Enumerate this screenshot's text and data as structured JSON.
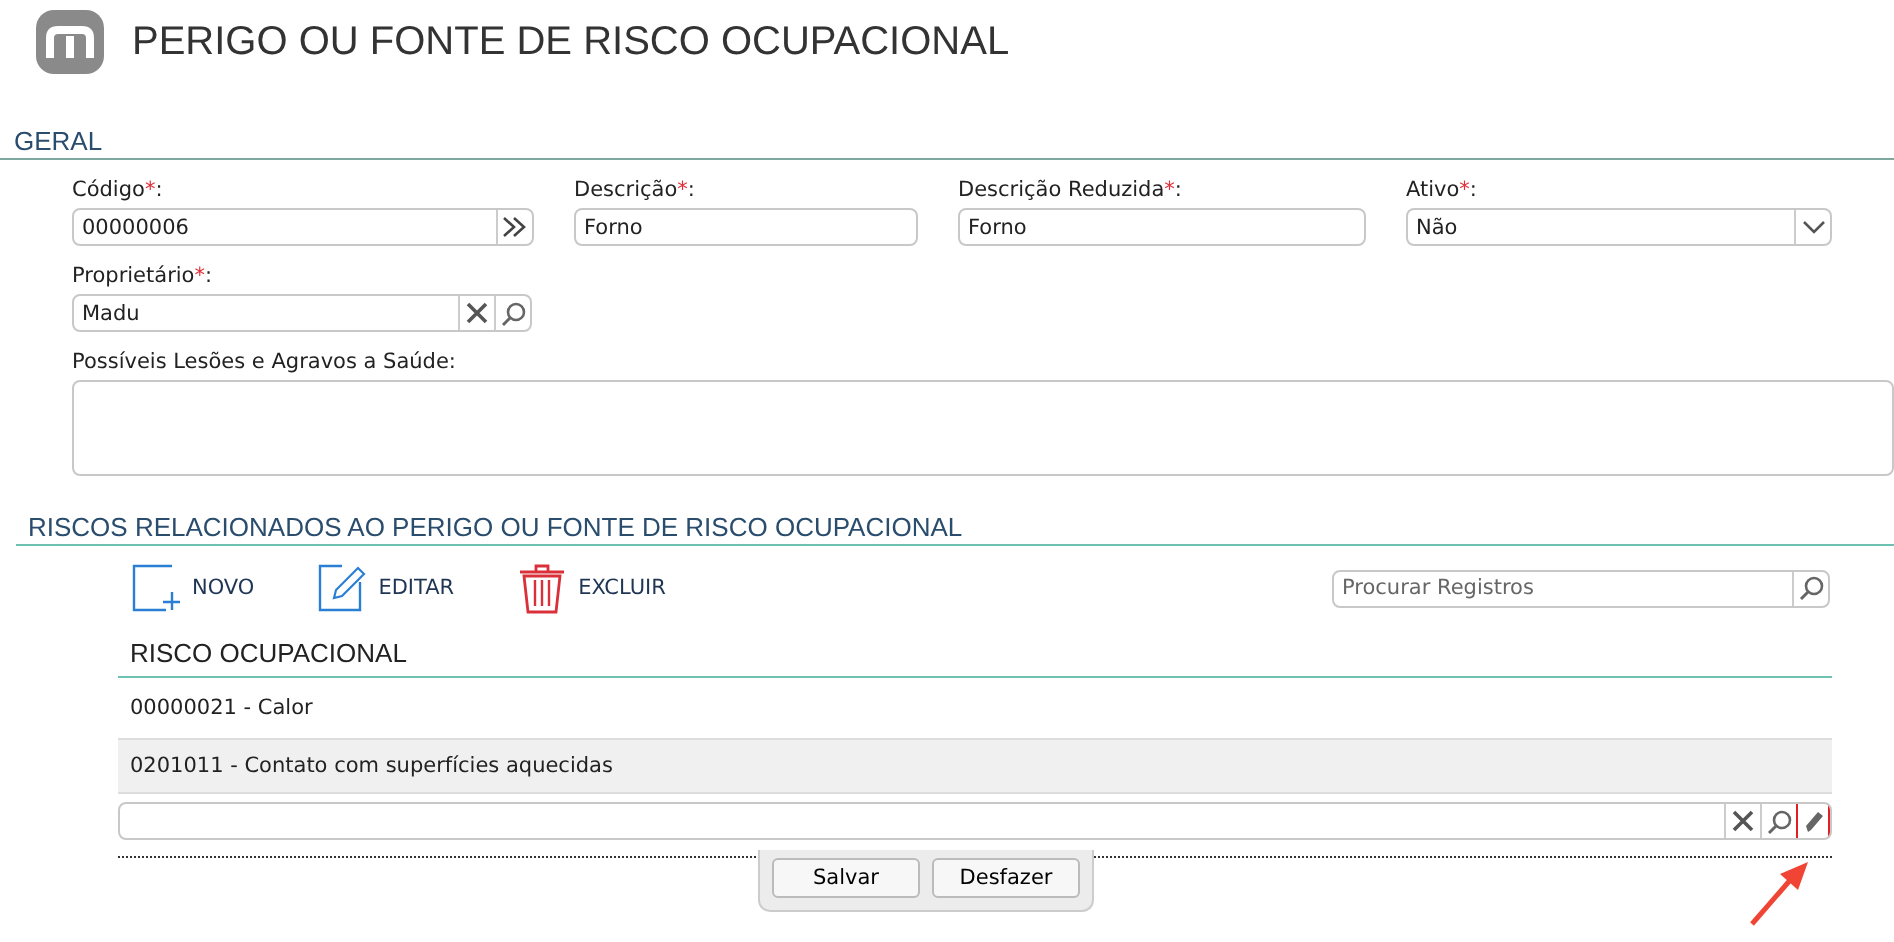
{
  "page_title": "PERIGO OU FONTE DE RISCO OCUPACIONAL",
  "general": {
    "title": "GERAL",
    "rows": [
      [
        {
          "kind": "code",
          "label": "Código",
          "required_mark": "*",
          "suffix": ":",
          "value": "00000006"
        },
        {
          "kind": "text",
          "label": "Descrição",
          "required_mark": "*",
          "suffix": ":",
          "value": "Forno"
        },
        {
          "kind": "text",
          "label": "Descrição Reduzida",
          "required_mark": "*",
          "suffix": ":",
          "value": "Forno"
        },
        {
          "kind": "select",
          "label": "Ativo",
          "required_mark": "*",
          "suffix": ":",
          "value": "Não"
        }
      ],
      [
        {
          "kind": "lookup",
          "label": "Proprietário",
          "required_mark": "*",
          "suffix": ":",
          "value": "Madu"
        }
      ],
      [
        {
          "kind": "textarea",
          "label": "Possíveis Lesões e Agravos a Saúde",
          "suffix": ":"
        }
      ]
    ]
  },
  "related": {
    "title": "RISCOS RELACIONADOS AO PERIGO OU FONTE DE RISCO OCUPACIONAL",
    "toolbar": [
      {
        "kind": "new",
        "label": "NOVO"
      },
      {
        "kind": "edit",
        "label": "EDITAR"
      },
      {
        "kind": "delete",
        "label": "EXCLUIR"
      }
    ],
    "search": {
      "placeholder": "Procurar Registros"
    },
    "table": {
      "column": "RISCO OCUPACIONAL",
      "rows": [
        {
          "text": "00000021 - Calor",
          "selected": false
        },
        {
          "text": "0201011 - Contato com superfícies aquecidas",
          "selected": true
        }
      ]
    },
    "edit_highlighted": true
  },
  "buttons": [
    "Salvar",
    "Desfazer"
  ]
}
